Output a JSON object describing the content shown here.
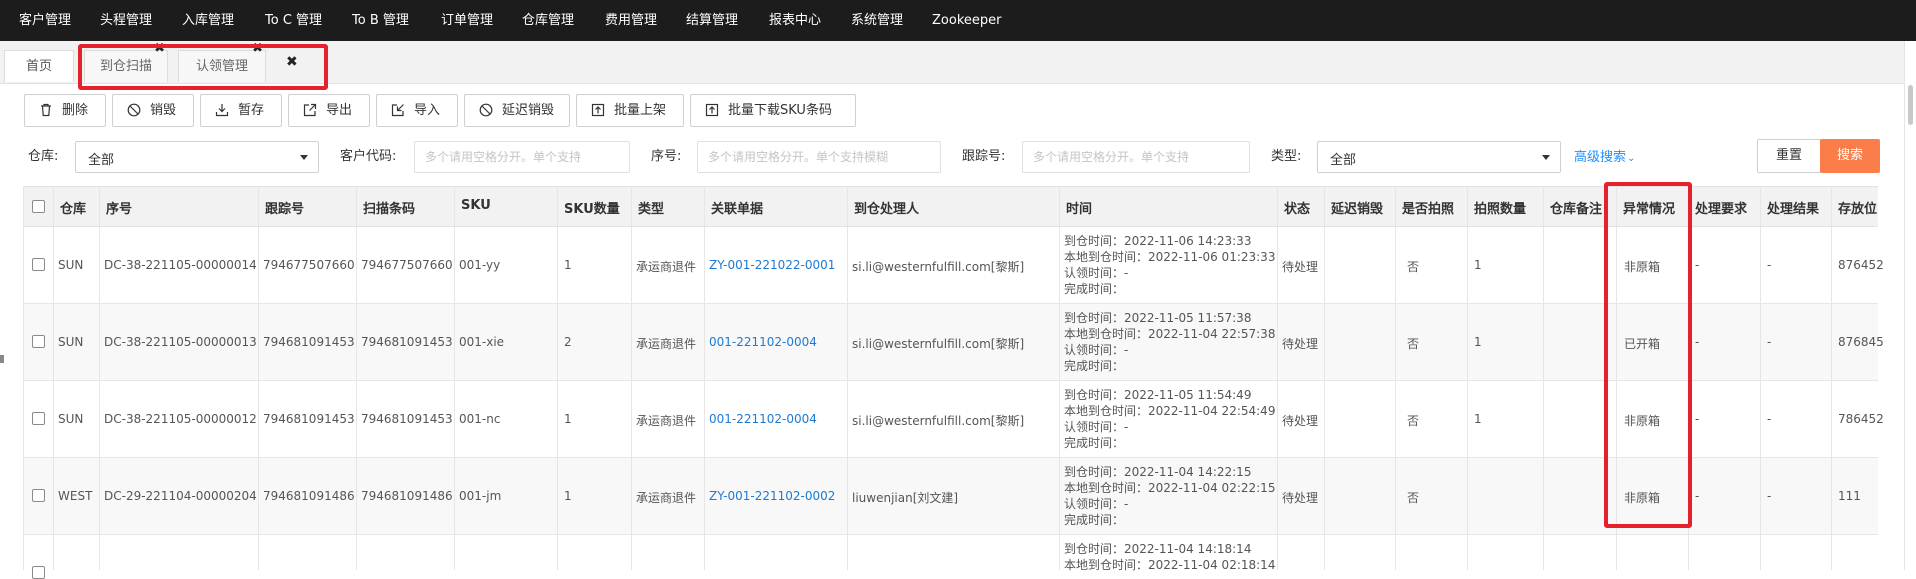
{
  "nav": [
    "客户管理",
    "头程管理",
    "入库管理",
    "To C 管理",
    "To B 管理",
    "订单管理",
    "仓库管理",
    "费用管理",
    "结算管理",
    "报表中心",
    "系统管理",
    "Zookeeper"
  ],
  "tabs": {
    "home": "首页",
    "tab1": "到仓扫描",
    "tab2": "认领管理",
    "close_glyph": "✖"
  },
  "toolbar": {
    "delete": "删除",
    "destroy": "销毁",
    "hold": "暂存",
    "export": "导出",
    "import": "导入",
    "delay_destroy": "延迟销毁",
    "batch_shelve": "批量上架",
    "batch_download_sku": "批量下载SKU条码"
  },
  "filters": {
    "warehouse_label": "仓库:",
    "warehouse_value": "全部",
    "customer_code_label": "客户代码:",
    "customer_code_placeholder": "多个请用空格分开。单个支持",
    "seq_label": "序号:",
    "seq_placeholder": "多个请用空格分开。单个支持模糊",
    "tracking_label": "跟踪号:",
    "tracking_placeholder": "多个请用空格分开。单个支持",
    "type_label": "类型:",
    "type_value": "全部",
    "advanced": "高级搜索",
    "reset": "重置",
    "search": "搜索"
  },
  "table": {
    "headers": {
      "warehouse": "仓库",
      "seq": "序号",
      "tracking": "跟踪号",
      "scan_code": "扫描条码",
      "sku": "SKU",
      "sku_qty": "SKU数量",
      "type": "类型",
      "related": "关联单据",
      "handler": "到仓处理人",
      "time": "时间",
      "status": "状态",
      "delay_destroy": "延迟销毁",
      "photo": "是否拍照",
      "photo_qty": "拍照数量",
      "wh_note": "仓库备注",
      "exception": "异常情况",
      "req": "处理要求",
      "result": "处理结果",
      "location": "存放位"
    },
    "rows": [
      {
        "warehouse": "SUN",
        "seq": "DC-38-221105-00000014",
        "tracking": "794677507660",
        "scan_code": "794677507660",
        "sku": "001-yy",
        "sku_qty": "1",
        "type": "承运商退件",
        "related": "ZY-001-221022-0001",
        "handler": "si.li@westernfulfill.com[黎斯]",
        "time1": "到仓时间：2022-11-06 14:23:33",
        "time2": "本地到仓时间：2022-11-06 01:23:33",
        "time3": "认领时间：-",
        "time4": "完成时间：",
        "status": "待处理",
        "delay_destroy": "",
        "photo": "否",
        "photo_qty": "1",
        "wh_note": "",
        "exception": "非原箱",
        "req": "-",
        "result": "-",
        "location": "876452"
      },
      {
        "warehouse": "SUN",
        "seq": "DC-38-221105-00000013",
        "tracking": "794681091453",
        "scan_code": "794681091453",
        "sku": "001-xie",
        "sku_qty": "2",
        "type": "承运商退件",
        "related": "001-221102-0004",
        "handler": "si.li@westernfulfill.com[黎斯]",
        "time1": "到仓时间：2022-11-05 11:57:38",
        "time2": "本地到仓时间：2022-11-04 22:57:38",
        "time3": "认领时间：-",
        "time4": "完成时间：",
        "status": "待处理",
        "delay_destroy": "",
        "photo": "否",
        "photo_qty": "1",
        "wh_note": "",
        "exception": "已开箱",
        "req": "-",
        "result": "-",
        "location": "876845"
      },
      {
        "warehouse": "SUN",
        "seq": "DC-38-221105-00000012",
        "tracking": "794681091453",
        "scan_code": "794681091453",
        "sku": "001-nc",
        "sku_qty": "1",
        "type": "承运商退件",
        "related": "001-221102-0004",
        "handler": "si.li@westernfulfill.com[黎斯]",
        "time1": "到仓时间：2022-11-05 11:54:49",
        "time2": "本地到仓时间：2022-11-04 22:54:49",
        "time3": "认领时间：-",
        "time4": "完成时间：",
        "status": "待处理",
        "delay_destroy": "",
        "photo": "否",
        "photo_qty": "1",
        "wh_note": "",
        "exception": "非原箱",
        "req": "-",
        "result": "-",
        "location": "786452"
      },
      {
        "warehouse": "WEST",
        "seq": "DC-29-221104-00000204",
        "tracking": "794681091486",
        "scan_code": "794681091486",
        "sku": "001-jm",
        "sku_qty": "1",
        "type": "承运商退件",
        "related": "ZY-001-221102-0002",
        "handler": "liuwenjian[刘文建]",
        "time1": "到仓时间：2022-11-04 14:22:15",
        "time2": "本地到仓时间：2022-11-04 02:22:15",
        "time3": "认领时间：-",
        "time4": "完成时间：",
        "status": "待处理",
        "delay_destroy": "",
        "photo": "否",
        "photo_qty": "",
        "wh_note": "",
        "exception": "非原箱",
        "req": "-",
        "result": "-",
        "location": "111"
      },
      {
        "warehouse": "",
        "seq": "",
        "tracking": "",
        "scan_code": "",
        "sku": "",
        "sku_qty": "",
        "type": "",
        "related": "",
        "handler": "",
        "time1": "到仓时间：2022-11-04 14:18:14",
        "time2": "本地到仓时间：2022-11-04 02:18:14",
        "time3": "",
        "time4": "",
        "status": "",
        "delay_destroy": "",
        "photo": "",
        "photo_qty": "",
        "wh_note": "",
        "exception": "",
        "req": "",
        "result": "",
        "location": ""
      }
    ]
  },
  "colors": {
    "nav_bg": "#1c1c1c",
    "highlight_red": "#e5212b",
    "link_blue": "#1e7ad4",
    "search_orange": "#fb7d4a"
  }
}
